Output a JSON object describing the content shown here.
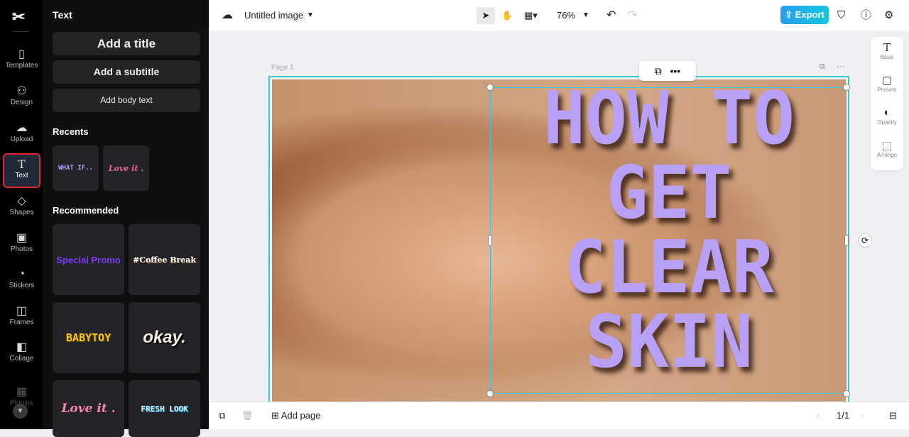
{
  "rail": {
    "items": [
      {
        "label": "Templates",
        "icon": "templates-icon"
      },
      {
        "label": "Design",
        "icon": "design-icon"
      },
      {
        "label": "Upload",
        "icon": "upload-icon"
      },
      {
        "label": "Text",
        "icon": "text-icon",
        "active": true
      },
      {
        "label": "Shapes",
        "icon": "shapes-icon"
      },
      {
        "label": "Photos",
        "icon": "photos-icon"
      },
      {
        "label": "Stickers",
        "icon": "stickers-icon"
      },
      {
        "label": "Frames",
        "icon": "frames-icon"
      },
      {
        "label": "Collage",
        "icon": "collage-icon"
      },
      {
        "label": "Plugins",
        "icon": "plugins-icon"
      }
    ]
  },
  "panel": {
    "title": "Text",
    "add_title": "Add a title",
    "add_subtitle": "Add a subtitle",
    "add_body": "Add body text",
    "recents_label": "Recents",
    "recents": [
      "WHAT IF..",
      "Love it ."
    ],
    "recommended_label": "Recommended",
    "recommended": [
      "Special Promo",
      "#Coffee Break",
      "BABYTOY",
      "okay.",
      "Love it .",
      "FRESH LOOK"
    ]
  },
  "topbar": {
    "doc_title": "Untitled image",
    "zoom": "76%",
    "export_label": "Export"
  },
  "canvas": {
    "page_label": "Page 1",
    "headline": [
      "HOW TO",
      "GET",
      "CLEAR",
      "SKIN"
    ],
    "headline_color": "#b8a0f6",
    "selection_color": "#3cc6d8"
  },
  "right_panel": {
    "items": [
      "Basic",
      "Presets",
      "Opacity",
      "Arrange"
    ]
  },
  "bottombar": {
    "add_page": "Add page",
    "page_count": "1/1"
  }
}
